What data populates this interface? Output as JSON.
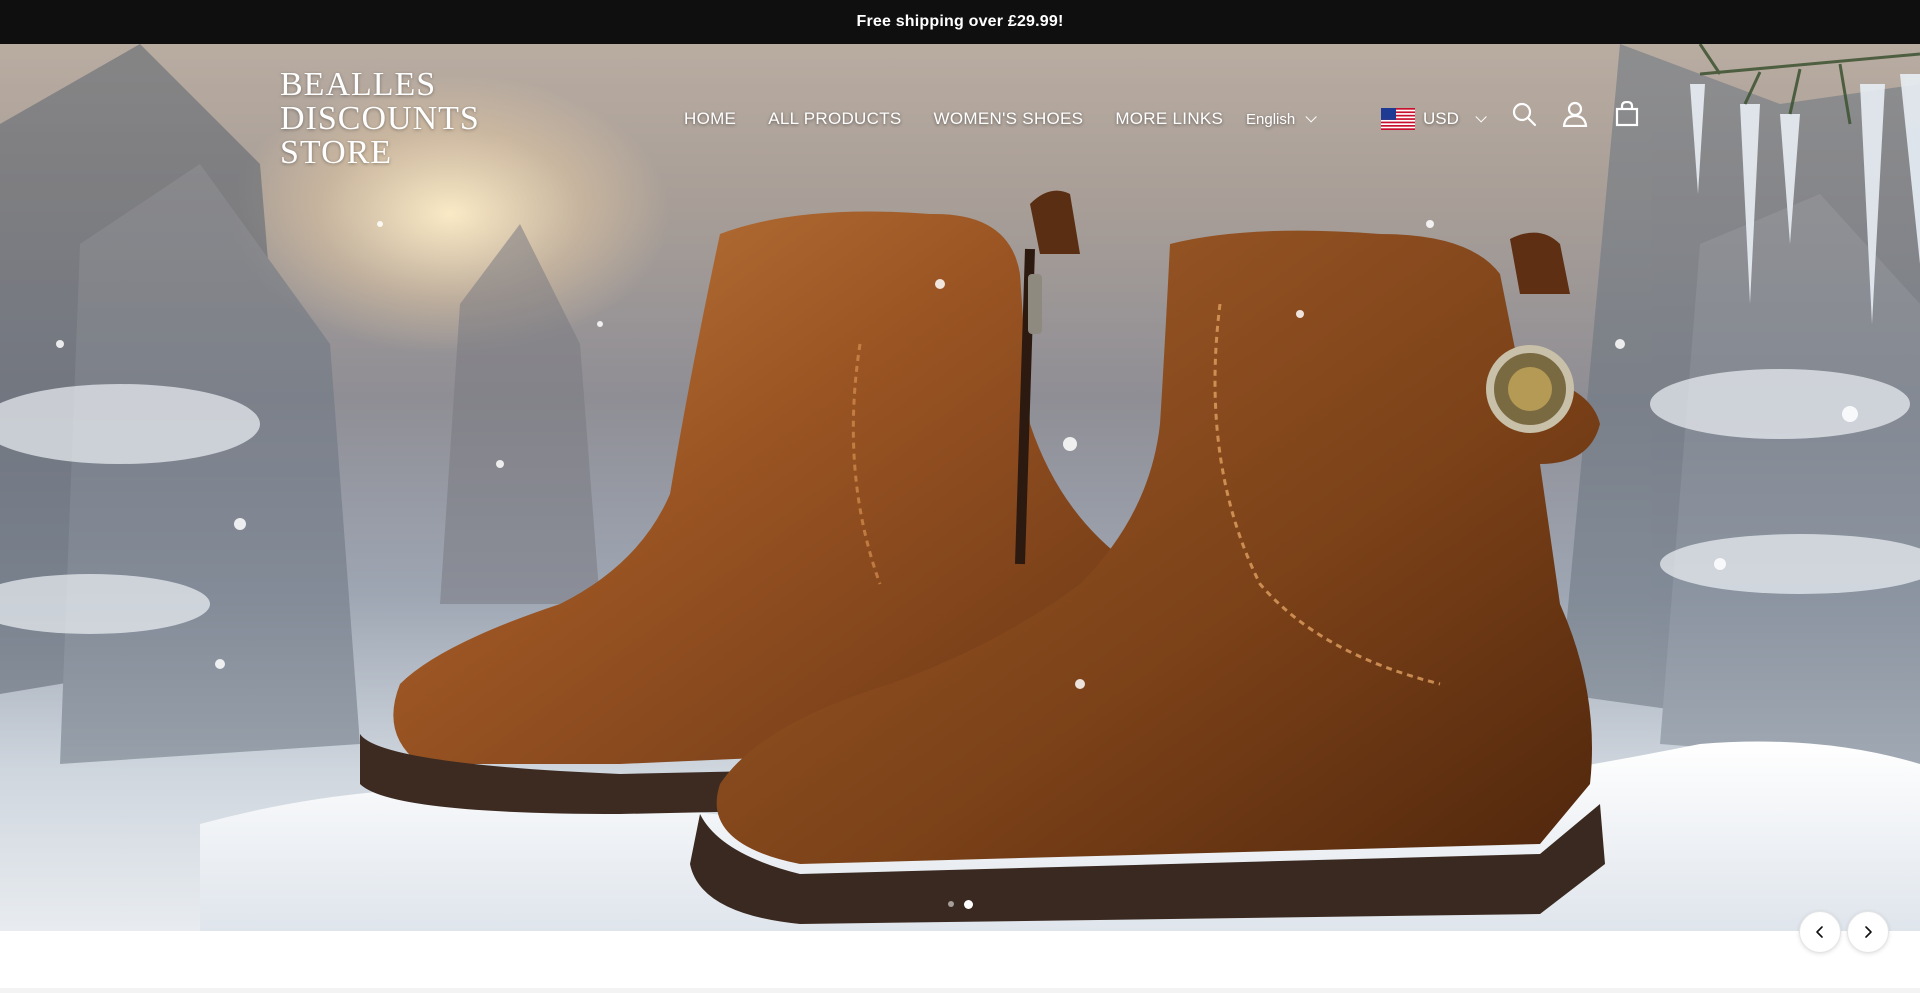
{
  "announcement": {
    "text": "Free shipping over £29.99!"
  },
  "logo": {
    "line1": "BEALLES",
    "line2": "DISCOUNTS",
    "line3": "STORE"
  },
  "nav": {
    "items": [
      {
        "label": "HOME"
      },
      {
        "label": "ALL PRODUCTS"
      },
      {
        "label": "WOMEN'S SHOES"
      },
      {
        "label": "MORE LINKS"
      }
    ]
  },
  "language": {
    "selected": "English"
  },
  "currency": {
    "selected": "USD",
    "flag": "us-flag-icon"
  },
  "header_icons": [
    "search-icon",
    "account-icon",
    "cart-bag-icon"
  ],
  "hero": {
    "image": "brown leather ankle boots on snowy wooden bench",
    "slides": {
      "count": 2,
      "active_index": 2
    }
  },
  "colors": {
    "announcement_bg": "#0f0f0f",
    "text_light": "#ffffff"
  }
}
